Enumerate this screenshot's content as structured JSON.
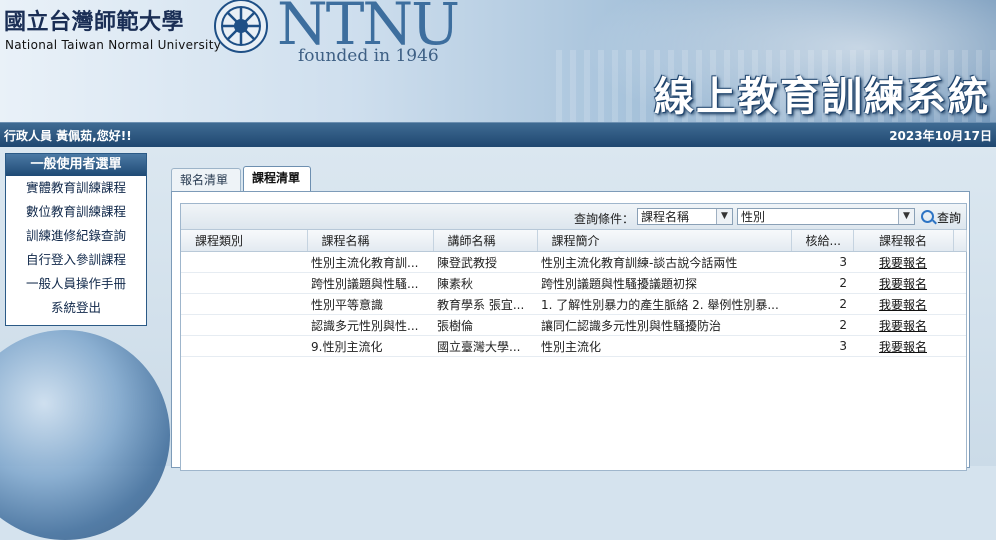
{
  "header": {
    "school_zh": "國立台灣師範大學",
    "school_en": "National Taiwan Normal University",
    "logo_text": "NTNU",
    "founded": "founded in 1946",
    "system_title": "線上教育訓練系統"
  },
  "topbar": {
    "greeting": "行政人員 黃佩茹,您好!!",
    "date": "2023年10月17日"
  },
  "sidebar": {
    "title": "一般使用者選單",
    "items": [
      {
        "label": "實體教育訓練課程"
      },
      {
        "label": "數位教育訓練課程"
      },
      {
        "label": "訓練進修紀錄查詢"
      },
      {
        "label": "自行登入參訓課程"
      },
      {
        "label": "一般人員操作手冊"
      },
      {
        "label": "系統登出"
      }
    ]
  },
  "tabs": [
    {
      "label": "報名清單",
      "active": false
    },
    {
      "label": "課程清單",
      "active": true
    }
  ],
  "search": {
    "label": "查詢條件：",
    "field_select": "課程名稱",
    "value_select": "性別",
    "button_label": "查詢"
  },
  "table": {
    "columns": [
      "課程類別",
      "課程名稱",
      "講師名稱",
      "課程簡介",
      "核給...",
      "課程報名"
    ],
    "rows": [
      {
        "category": "",
        "name": "性別主流化教育訓...",
        "lecturer": "陳登武教授",
        "intro": "性別主流化教育訓練-談古說今話兩性",
        "hours": "3",
        "action": "我要報名"
      },
      {
        "category": "",
        "name": "跨性別議題與性騷...",
        "lecturer": "陳素秋",
        "intro": "跨性別議題與性騷擾議題初探",
        "hours": "2",
        "action": "我要報名"
      },
      {
        "category": "",
        "name": "性別平等意識",
        "lecturer": "教育學系 張宜...",
        "intro": "1. 了解性別暴力的產生脈絡 2. 舉例性別暴...",
        "hours": "2",
        "action": "我要報名"
      },
      {
        "category": "",
        "name": "認識多元性別與性...",
        "lecturer": "張樹倫",
        "intro": "讓同仁認識多元性別與性騷擾防治",
        "hours": "2",
        "action": "我要報名"
      },
      {
        "category": "",
        "name": "9.性別主流化",
        "lecturer": "國立臺灣大學...",
        "intro": "性別主流化",
        "hours": "3",
        "action": "我要報名"
      }
    ]
  },
  "colors": {
    "topbar": "#1f4770",
    "sidebar_head": "#1f4a75",
    "title_outline": "#20456e"
  }
}
